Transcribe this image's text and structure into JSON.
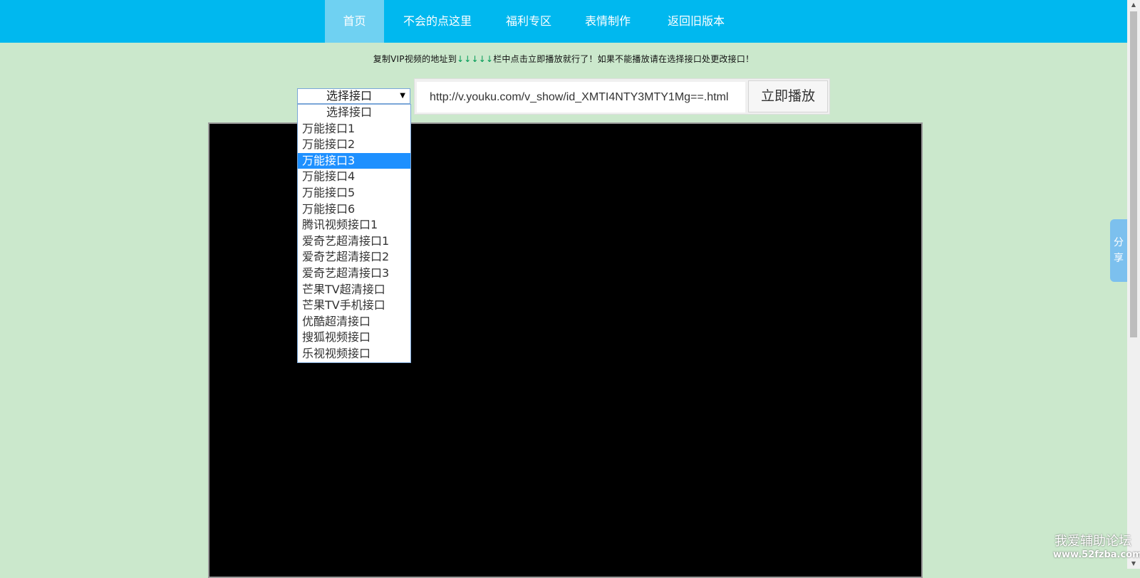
{
  "nav": {
    "items": [
      {
        "label": "首页",
        "active": true
      },
      {
        "label": "不会的点这里"
      },
      {
        "label": "福利专区"
      },
      {
        "label": "表情制作"
      },
      {
        "label": "返回旧版本"
      }
    ],
    "colors": {
      "background": "#00b8ef",
      "active": "#6fd1f2"
    }
  },
  "notice": {
    "before": "复制VIP视频的地址到",
    "arrows": "↓↓↓↓↓",
    "after": "栏中点击立即播放就行了！如果不能播放请在选择接口处更改接口！"
  },
  "interface_select": {
    "current": "选择接口",
    "options": [
      "选择接口",
      "万能接口1",
      "万能接口2",
      "万能接口3",
      "万能接口4",
      "万能接口5",
      "万能接口6",
      "腾讯视频接口1",
      "爱奇艺超清接口1",
      "爱奇艺超清接口2",
      "爱奇艺超清接口3",
      "芒果TV超清接口",
      "芒果TV手机接口",
      "优酷超清接口",
      "搜狐视频接口",
      "乐视视频接口"
    ],
    "highlighted": "万能接口3"
  },
  "url_input": {
    "value": "http://v.youku.com/v_show/id_XMTI4NTY3MTY1Mg==.html"
  },
  "play_button": {
    "label": "立即播放"
  },
  "share": {
    "label": "分享"
  },
  "watermark": {
    "title": "我爱辅助论坛",
    "url": "www.52fzba.com"
  },
  "colors": {
    "page_background": "#cbe8cc",
    "player_background": "#000000",
    "highlight": "#1e90ff"
  }
}
